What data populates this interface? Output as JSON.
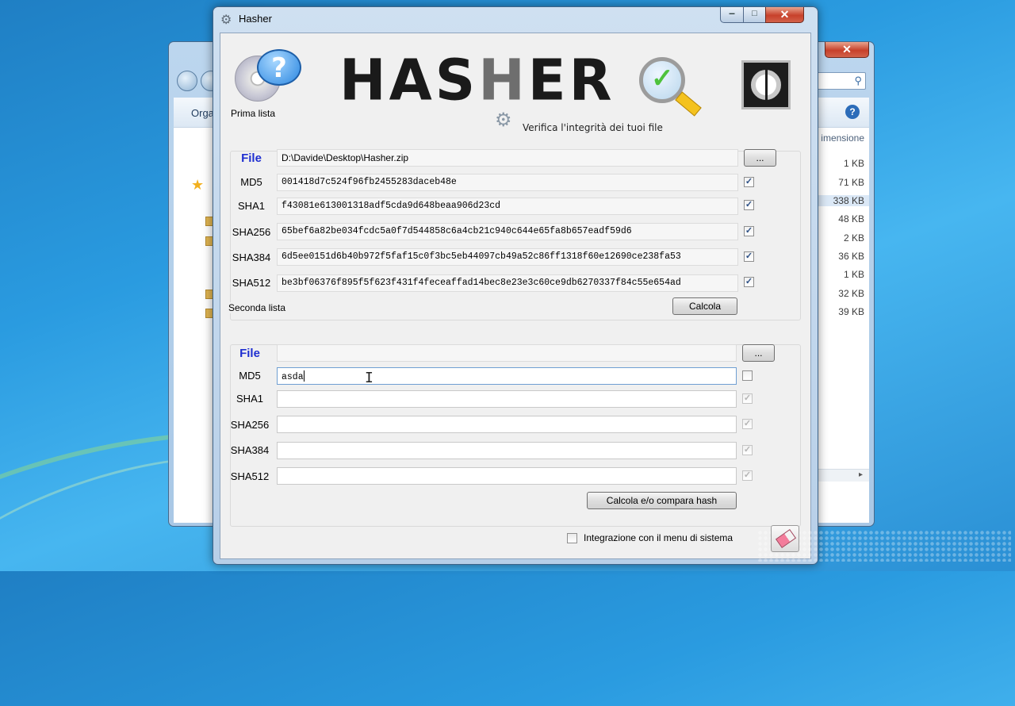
{
  "window": {
    "title": "Hasher"
  },
  "banner": {
    "title_dark": "HAS",
    "title_grey": "H",
    "title_end": "ER",
    "subtitle": "Verifica l'integrità dei tuoi file"
  },
  "first_list": {
    "group_label": "Prima lista",
    "file_label": "File",
    "file_path": "D:\\Davide\\Desktop\\Hasher.zip",
    "browse_label": "...",
    "rows": [
      {
        "label": "MD5",
        "value": "001418d7c524f96fb2455283daceb48e",
        "checked": true
      },
      {
        "label": "SHA1",
        "value": "f43081e613001318adf5cda9d648beaa906d23cd",
        "checked": true
      },
      {
        "label": "SHA256",
        "value": "65bef6a82be034fcdc5a0f7d544858c6a4cb21c940c644e65fa8b657eadf59d6",
        "checked": true
      },
      {
        "label": "SHA384",
        "value": "6d5ee0151d6b40b972f5faf15c0f3bc5eb44097cb49a52c86ff1318f60e12690ce238fa53",
        "checked": true
      },
      {
        "label": "SHA512",
        "value": "be3bf06376f895f5f623f431f4feceaffad14bec8e23e3c60ce9db6270337f84c55e654ad",
        "checked": true
      }
    ],
    "calc_button": "Calcola"
  },
  "second_list": {
    "group_label": "Seconda lista",
    "file_label": "File",
    "file_path": "",
    "browse_label": "...",
    "rows": [
      {
        "label": "MD5",
        "value": "asda",
        "checked": false
      },
      {
        "label": "SHA1",
        "value": "",
        "checked": true
      },
      {
        "label": "SHA256",
        "value": "",
        "checked": true
      },
      {
        "label": "SHA384",
        "value": "",
        "checked": true
      },
      {
        "label": "SHA512",
        "value": "",
        "checked": true
      }
    ],
    "compare_button": "Calcola e/o compara hash"
  },
  "footer": {
    "integration_label": "Integrazione con il menu di sistema",
    "integration_checked": false
  },
  "background_explorer": {
    "toolbar_label": "Orga",
    "column_header": "imensione",
    "sizes": [
      "1 KB",
      "71 KB",
      "338 KB",
      "48 KB",
      "2 KB",
      "36 KB",
      "1 KB",
      "32 KB",
      "39 KB"
    ]
  },
  "icons": {
    "check": "✓",
    "close": "✕",
    "gear": "⚙",
    "help": "?",
    "search": "⚲",
    "star": "★"
  }
}
